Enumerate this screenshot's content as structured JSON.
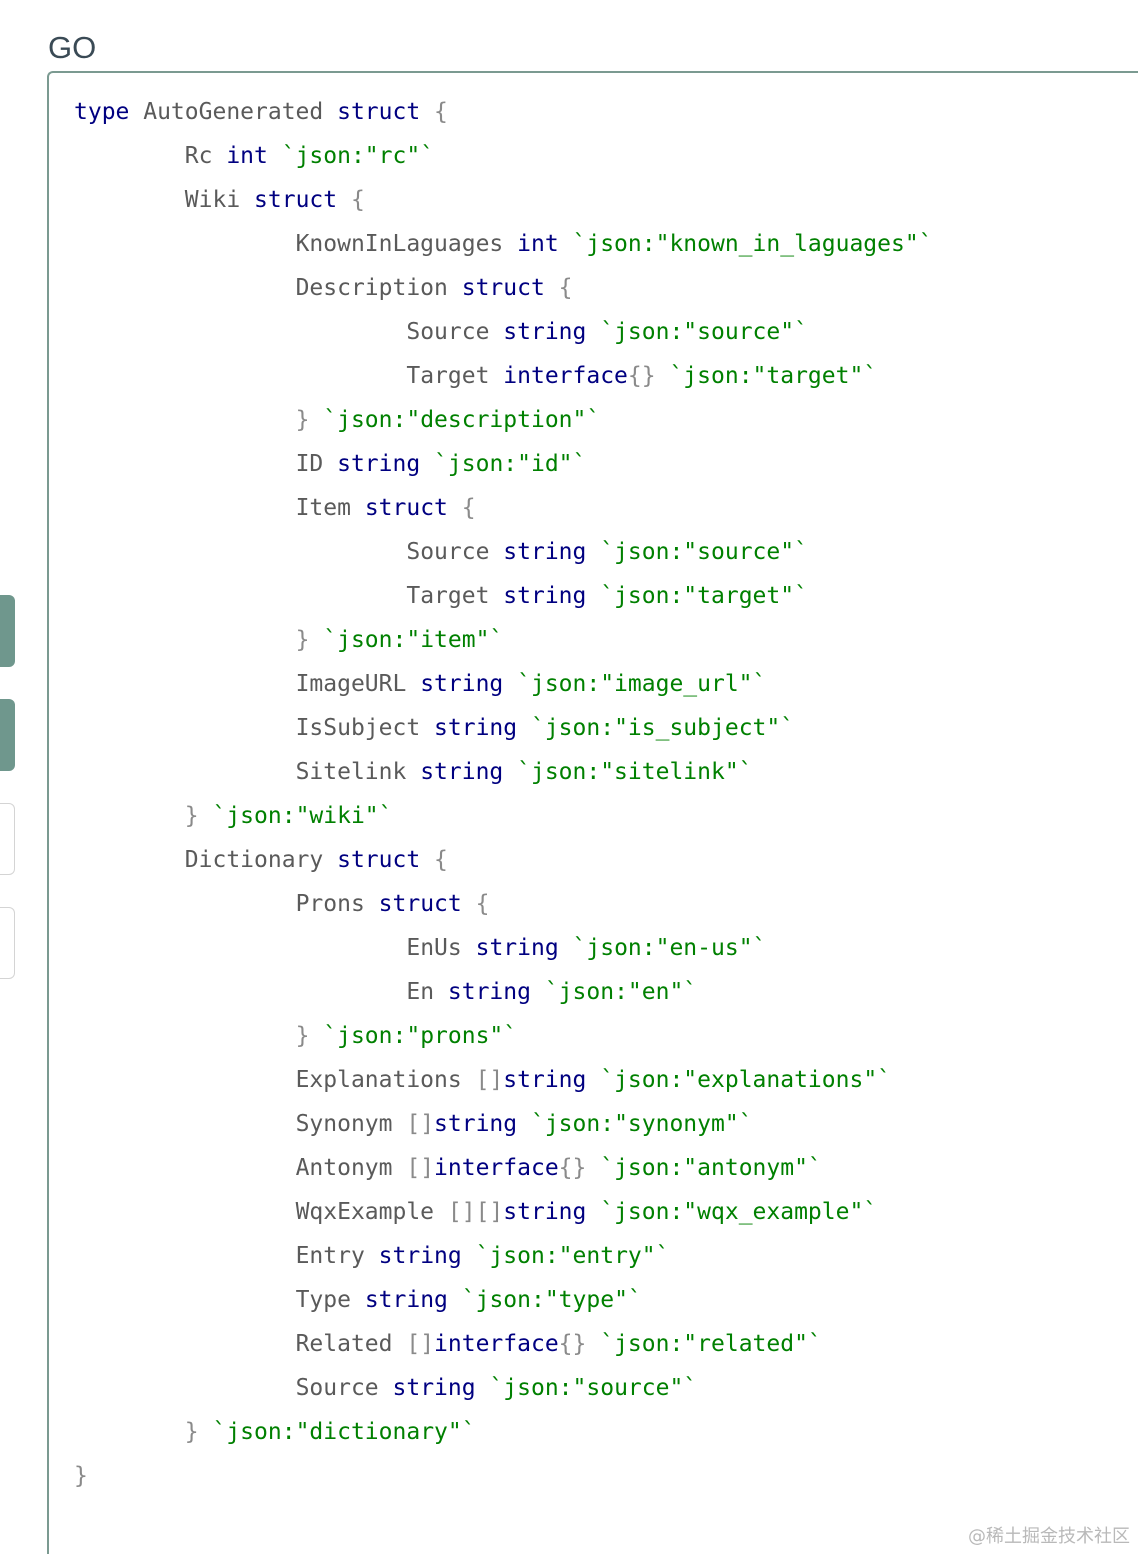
{
  "language_label": "GO",
  "watermark": "@稀土掘金技术社区",
  "colors": {
    "keyword": "#000080",
    "identifier": "#5a5a5a",
    "punctuation": "#8a8a8a",
    "struct_tag": "#008000",
    "accent_border": "#7b9a91",
    "side_tab": "#6f978d"
  },
  "side_tabs": [
    {
      "style": "filled"
    },
    {
      "style": "filled"
    },
    {
      "style": "outline"
    },
    {
      "style": "outline"
    }
  ],
  "code_lines": [
    {
      "indent": 0,
      "tokens": [
        {
          "t": "kw",
          "v": "type"
        },
        {
          "t": "id",
          "v": " AutoGenerated "
        },
        {
          "t": "kw",
          "v": "struct"
        },
        {
          "t": "p",
          "v": " {"
        }
      ]
    },
    {
      "indent": 1,
      "tokens": [
        {
          "t": "id",
          "v": "Rc "
        },
        {
          "t": "kw",
          "v": "int"
        },
        {
          "t": "tag",
          "v": " `json:\"rc\"`"
        }
      ]
    },
    {
      "indent": 1,
      "tokens": [
        {
          "t": "id",
          "v": "Wiki "
        },
        {
          "t": "kw",
          "v": "struct"
        },
        {
          "t": "p",
          "v": " {"
        }
      ]
    },
    {
      "indent": 2,
      "tokens": [
        {
          "t": "id",
          "v": "KnownInLaguages "
        },
        {
          "t": "kw",
          "v": "int"
        },
        {
          "t": "tag",
          "v": " `json:\"known_in_laguages\"`"
        }
      ]
    },
    {
      "indent": 2,
      "tokens": [
        {
          "t": "id",
          "v": "Description "
        },
        {
          "t": "kw",
          "v": "struct"
        },
        {
          "t": "p",
          "v": " {"
        }
      ]
    },
    {
      "indent": 3,
      "tokens": [
        {
          "t": "id",
          "v": "Source "
        },
        {
          "t": "kw",
          "v": "string"
        },
        {
          "t": "tag",
          "v": " `json:\"source\"`"
        }
      ]
    },
    {
      "indent": 3,
      "tokens": [
        {
          "t": "id",
          "v": "Target "
        },
        {
          "t": "kw",
          "v": "interface"
        },
        {
          "t": "p",
          "v": "{}"
        },
        {
          "t": "tag",
          "v": " `json:\"target\"`"
        }
      ]
    },
    {
      "indent": 2,
      "tokens": [
        {
          "t": "p",
          "v": "}"
        },
        {
          "t": "tag",
          "v": " `json:\"description\"`"
        }
      ]
    },
    {
      "indent": 2,
      "tokens": [
        {
          "t": "id",
          "v": "ID "
        },
        {
          "t": "kw",
          "v": "string"
        },
        {
          "t": "tag",
          "v": " `json:\"id\"`"
        }
      ]
    },
    {
      "indent": 2,
      "tokens": [
        {
          "t": "id",
          "v": "Item "
        },
        {
          "t": "kw",
          "v": "struct"
        },
        {
          "t": "p",
          "v": " {"
        }
      ]
    },
    {
      "indent": 3,
      "tokens": [
        {
          "t": "id",
          "v": "Source "
        },
        {
          "t": "kw",
          "v": "string"
        },
        {
          "t": "tag",
          "v": " `json:\"source\"`"
        }
      ]
    },
    {
      "indent": 3,
      "tokens": [
        {
          "t": "id",
          "v": "Target "
        },
        {
          "t": "kw",
          "v": "string"
        },
        {
          "t": "tag",
          "v": " `json:\"target\"`"
        }
      ]
    },
    {
      "indent": 2,
      "tokens": [
        {
          "t": "p",
          "v": "}"
        },
        {
          "t": "tag",
          "v": " `json:\"item\"`"
        }
      ]
    },
    {
      "indent": 2,
      "tokens": [
        {
          "t": "id",
          "v": "ImageURL "
        },
        {
          "t": "kw",
          "v": "string"
        },
        {
          "t": "tag",
          "v": " `json:\"image_url\"`"
        }
      ]
    },
    {
      "indent": 2,
      "tokens": [
        {
          "t": "id",
          "v": "IsSubject "
        },
        {
          "t": "kw",
          "v": "string"
        },
        {
          "t": "tag",
          "v": " `json:\"is_subject\"`"
        }
      ]
    },
    {
      "indent": 2,
      "tokens": [
        {
          "t": "id",
          "v": "Sitelink "
        },
        {
          "t": "kw",
          "v": "string"
        },
        {
          "t": "tag",
          "v": " `json:\"sitelink\"`"
        }
      ]
    },
    {
      "indent": 1,
      "tokens": [
        {
          "t": "p",
          "v": "}"
        },
        {
          "t": "tag",
          "v": " `json:\"wiki\"`"
        }
      ]
    },
    {
      "indent": 1,
      "tokens": [
        {
          "t": "id",
          "v": "Dictionary "
        },
        {
          "t": "kw",
          "v": "struct"
        },
        {
          "t": "p",
          "v": " {"
        }
      ]
    },
    {
      "indent": 2,
      "tokens": [
        {
          "t": "id",
          "v": "Prons "
        },
        {
          "t": "kw",
          "v": "struct"
        },
        {
          "t": "p",
          "v": " {"
        }
      ]
    },
    {
      "indent": 3,
      "tokens": [
        {
          "t": "id",
          "v": "EnUs "
        },
        {
          "t": "kw",
          "v": "string"
        },
        {
          "t": "tag",
          "v": " `json:\"en-us\"`"
        }
      ]
    },
    {
      "indent": 3,
      "tokens": [
        {
          "t": "id",
          "v": "En "
        },
        {
          "t": "kw",
          "v": "string"
        },
        {
          "t": "tag",
          "v": " `json:\"en\"`"
        }
      ]
    },
    {
      "indent": 2,
      "tokens": [
        {
          "t": "p",
          "v": "}"
        },
        {
          "t": "tag",
          "v": " `json:\"prons\"`"
        }
      ]
    },
    {
      "indent": 2,
      "tokens": [
        {
          "t": "id",
          "v": "Explanations "
        },
        {
          "t": "p",
          "v": "[]"
        },
        {
          "t": "kw",
          "v": "string"
        },
        {
          "t": "tag",
          "v": " `json:\"explanations\"`"
        }
      ]
    },
    {
      "indent": 2,
      "tokens": [
        {
          "t": "id",
          "v": "Synonym "
        },
        {
          "t": "p",
          "v": "[]"
        },
        {
          "t": "kw",
          "v": "string"
        },
        {
          "t": "tag",
          "v": " `json:\"synonym\"`"
        }
      ]
    },
    {
      "indent": 2,
      "tokens": [
        {
          "t": "id",
          "v": "Antonym "
        },
        {
          "t": "p",
          "v": "[]"
        },
        {
          "t": "kw",
          "v": "interface"
        },
        {
          "t": "p",
          "v": "{}"
        },
        {
          "t": "tag",
          "v": " `json:\"antonym\"`"
        }
      ]
    },
    {
      "indent": 2,
      "tokens": [
        {
          "t": "id",
          "v": "WqxExample "
        },
        {
          "t": "p",
          "v": "[][]"
        },
        {
          "t": "kw",
          "v": "string"
        },
        {
          "t": "tag",
          "v": " `json:\"wqx_example\"`"
        }
      ]
    },
    {
      "indent": 2,
      "tokens": [
        {
          "t": "id",
          "v": "Entry "
        },
        {
          "t": "kw",
          "v": "string"
        },
        {
          "t": "tag",
          "v": " `json:\"entry\"`"
        }
      ]
    },
    {
      "indent": 2,
      "tokens": [
        {
          "t": "id",
          "v": "Type "
        },
        {
          "t": "kw",
          "v": "string"
        },
        {
          "t": "tag",
          "v": " `json:\"type\"`"
        }
      ]
    },
    {
      "indent": 2,
      "tokens": [
        {
          "t": "id",
          "v": "Related "
        },
        {
          "t": "p",
          "v": "[]"
        },
        {
          "t": "kw",
          "v": "interface"
        },
        {
          "t": "p",
          "v": "{}"
        },
        {
          "t": "tag",
          "v": " `json:\"related\"`"
        }
      ]
    },
    {
      "indent": 2,
      "tokens": [
        {
          "t": "id",
          "v": "Source "
        },
        {
          "t": "kw",
          "v": "string"
        },
        {
          "t": "tag",
          "v": " `json:\"source\"`"
        }
      ]
    },
    {
      "indent": 1,
      "tokens": [
        {
          "t": "p",
          "v": "}"
        },
        {
          "t": "tag",
          "v": " `json:\"dictionary\"`"
        }
      ]
    },
    {
      "indent": 0,
      "tokens": [
        {
          "t": "p",
          "v": "}"
        }
      ]
    }
  ]
}
